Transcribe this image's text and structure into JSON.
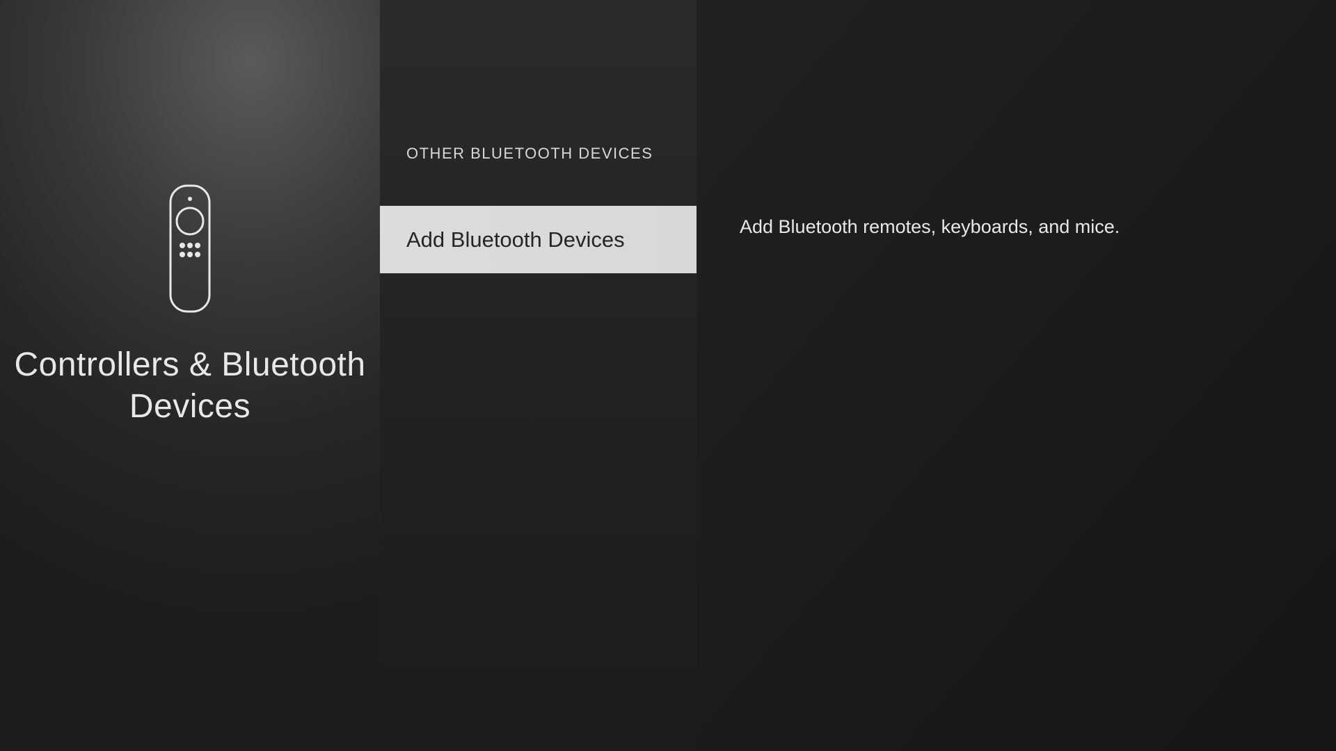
{
  "leftPanel": {
    "categoryTitle": "Controllers & Bluetooth Devices"
  },
  "centerPanel": {
    "sectionHeader": "OTHER BLUETOOTH DEVICES",
    "menuItems": [
      {
        "label": "Add Bluetooth Devices",
        "selected": true
      }
    ]
  },
  "rightPanel": {
    "description": "Add Bluetooth remotes, keyboards, and mice."
  }
}
